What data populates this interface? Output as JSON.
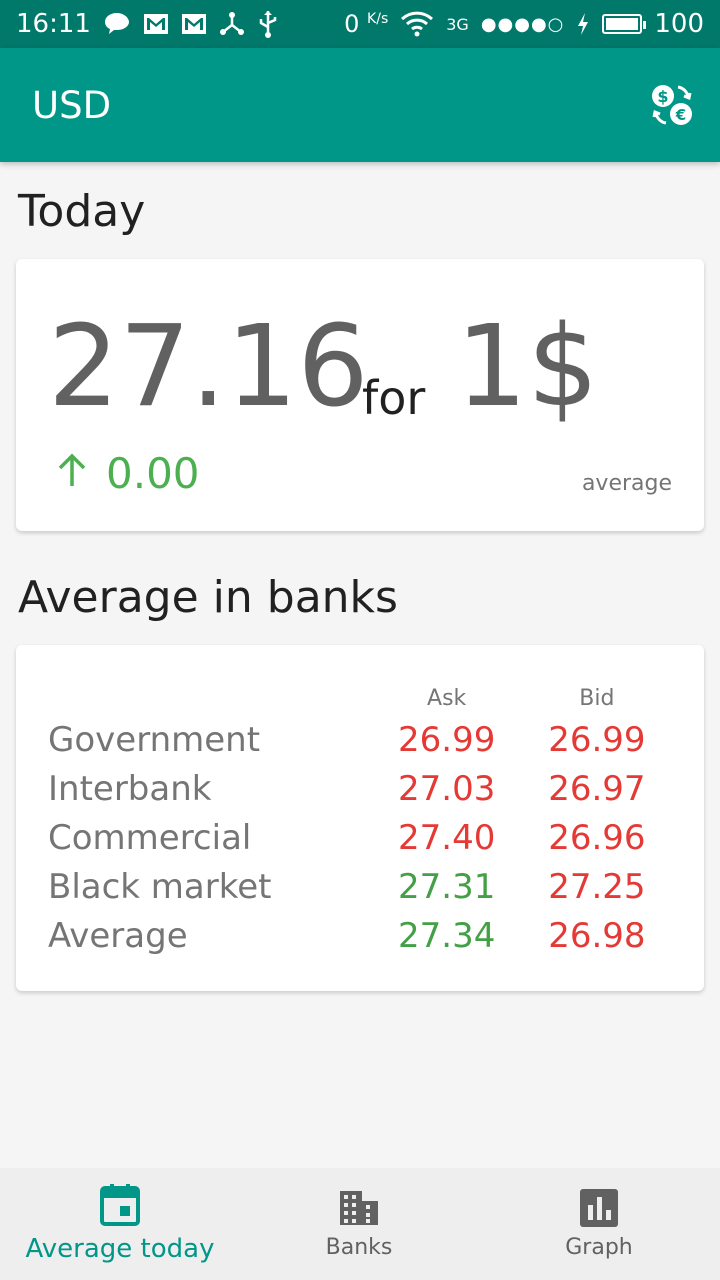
{
  "status_bar": {
    "time": "16:11",
    "net_speed_value": "0",
    "net_speed_unit": "K/s",
    "network_type": "3G",
    "signal": "●●●●○",
    "battery": "100"
  },
  "app_bar": {
    "title": "USD",
    "exchange_icon": "currency-exchange-icon"
  },
  "today": {
    "section_title": "Today",
    "rate": "27.16",
    "for_text": "for",
    "unit": "1$",
    "change": "0.00",
    "change_direction_icon": "arrow-up-icon",
    "label": "average"
  },
  "banks": {
    "section_title": "Average in banks",
    "headers": {
      "ask": "Ask",
      "bid": "Bid"
    },
    "rows": [
      {
        "name": "Government",
        "ask": "26.99",
        "bid": "26.99",
        "ask_color": "red",
        "bid_color": "red"
      },
      {
        "name": "Interbank",
        "ask": "27.03",
        "bid": "26.97",
        "ask_color": "red",
        "bid_color": "red"
      },
      {
        "name": "Commercial",
        "ask": "27.40",
        "bid": "26.96",
        "ask_color": "red",
        "bid_color": "red"
      },
      {
        "name": "Black market",
        "ask": "27.31",
        "bid": "27.25",
        "ask_color": "green",
        "bid_color": "red"
      },
      {
        "name": "Average",
        "ask": "27.34",
        "bid": "26.98",
        "ask_color": "green",
        "bid_color": "red"
      }
    ]
  },
  "bottom_nav": {
    "items": [
      {
        "label": "Average today",
        "icon": "calendar-icon",
        "active": true
      },
      {
        "label": "Banks",
        "icon": "building-icon",
        "active": false
      },
      {
        "label": "Graph",
        "icon": "bar-chart-icon",
        "active": false
      }
    ]
  },
  "colors": {
    "status_bar": "#00796b",
    "primary": "#009688",
    "up": "#4caf50",
    "down": "#e53935"
  }
}
